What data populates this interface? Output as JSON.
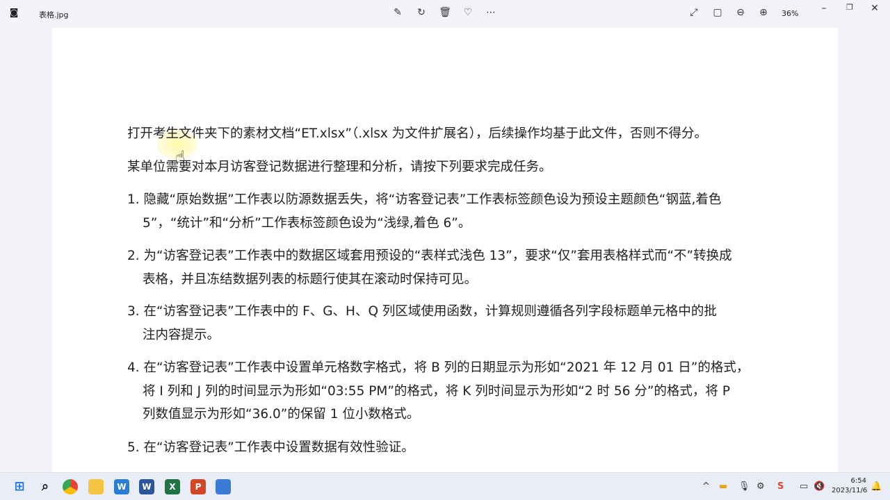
{
  "window": {
    "filename": "表格.jpg",
    "zoom": "36%"
  },
  "document": {
    "intro": "打开考生文件夹下的素材文档“ET.xlsx”（.xlsx 为文件扩展名），后续操作均基于此文件，否则不得分。",
    "task": "某单位需要对本月访客登记数据进行整理和分析，请按下列要求完成任务。",
    "items": [
      {
        "l1": "1. 隐藏“原始数据”工作表以防源数据丢失，将“访客登记表”工作表标签颜色设为预设主题颜色“钢蓝,着色",
        "l2": "5”，“统计”和“分析”工作表标签颜色设为“浅绿,着色 6”。"
      },
      {
        "l1": "2. 为“访客登记表”工作表中的数据区域套用预设的“表样式浅色 13”，要求“仅”套用表格样式而“不”转换成",
        "l2": "表格，并且冻结数据列表的标题行使其在滚动时保持可见。"
      },
      {
        "l1": "3. 在“访客登记表”工作表中的 F、G、H、Q 列区域使用函数，计算规则遵循各列字段标题单元格中的批",
        "l2": "注内容提示。"
      },
      {
        "l1": "4. 在“访客登记表”工作表中设置单元格数字格式，将 B 列的日期显示为形如“2021 年 12 月 01 日”的格式，",
        "l2": "将 I 列和 J 列的时间显示为形如“03:55 PM”的格式，将 K 列时间显示为形如“2 时 56 分”的格式，将 P",
        "l3": "列数值显示为形如“36.0”的保留 1 位小数格式。"
      },
      {
        "l1": "5. 在“访客登记表”工作表中设置数据有效性验证。"
      }
    ]
  },
  "taskbar": {
    "time": "6:54",
    "date": "2023/11/6",
    "apps": [
      "W",
      "W",
      "X",
      "P"
    ]
  }
}
